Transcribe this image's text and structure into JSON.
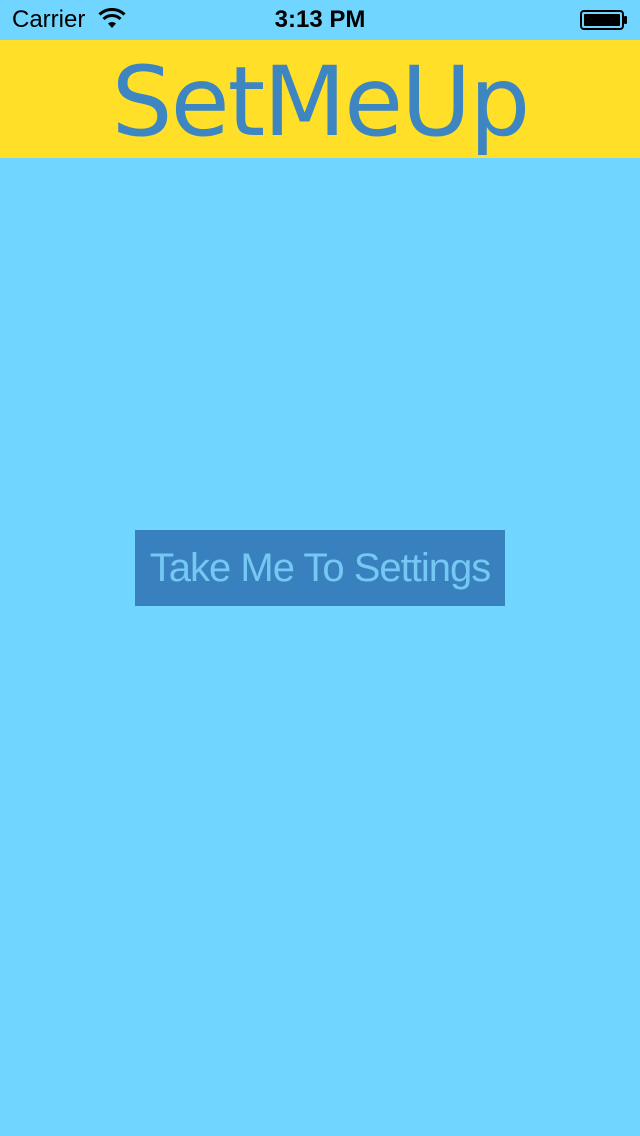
{
  "status_bar": {
    "carrier": "Carrier",
    "time": "3:13 PM",
    "icons": [
      "wifi-icon",
      "battery-icon"
    ]
  },
  "header": {
    "title": "SetMeUp",
    "background_color": "#ffdf27",
    "title_color": "#3d86c2"
  },
  "main": {
    "background_color": "#70d6ff",
    "settings_button_label": "Take Me To Settings",
    "button_color": "#3981be",
    "button_text_color": "#74c8f3"
  }
}
